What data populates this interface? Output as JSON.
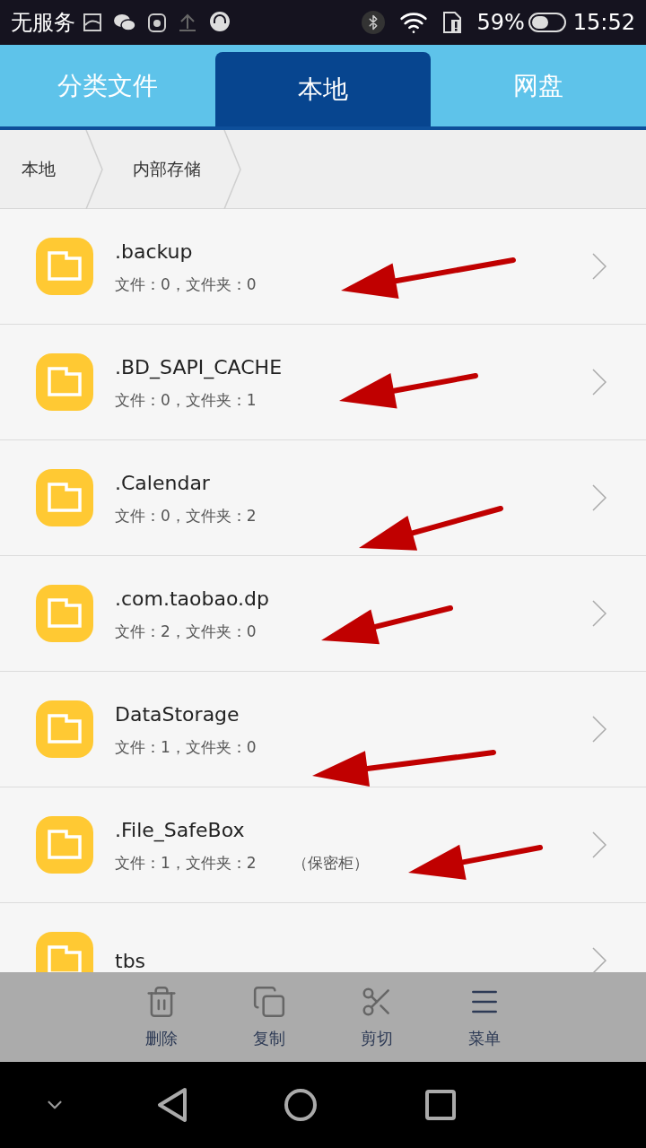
{
  "status_bar": {
    "carrier": "无服务",
    "battery": "59%",
    "time": "15:52"
  },
  "tabs": [
    {
      "label": "分类文件",
      "selected": false
    },
    {
      "label": "本地",
      "selected": true
    },
    {
      "label": "网盘",
      "selected": false
    }
  ],
  "breadcrumb": [
    "本地",
    "内部存储"
  ],
  "folders": [
    {
      "name": ".backup",
      "details": "文件：0，文件夹：0",
      "annotated": true
    },
    {
      "name": ".BD_SAPI_CACHE",
      "details": "文件：0，文件夹：1",
      "annotated": true
    },
    {
      "name": ".Calendar",
      "details": "文件：0，文件夹：2",
      "annotated": true
    },
    {
      "name": ".com.taobao.dp",
      "details": "文件：2，文件夹：0",
      "annotated": true
    },
    {
      "name": "DataStorage",
      "details": "文件：1，文件夹：0",
      "annotated": true
    },
    {
      "name": ".File_SafeBox",
      "details": "文件：1，文件夹：2",
      "note": "（保密柜）",
      "annotated": true
    },
    {
      "name": "tbs",
      "annotated": false
    }
  ],
  "toolbar": [
    {
      "kind": "delete",
      "label": "删除"
    },
    {
      "kind": "copy",
      "label": "复制"
    },
    {
      "kind": "cut",
      "label": "剪切"
    },
    {
      "kind": "menu",
      "label": "菜单"
    }
  ]
}
